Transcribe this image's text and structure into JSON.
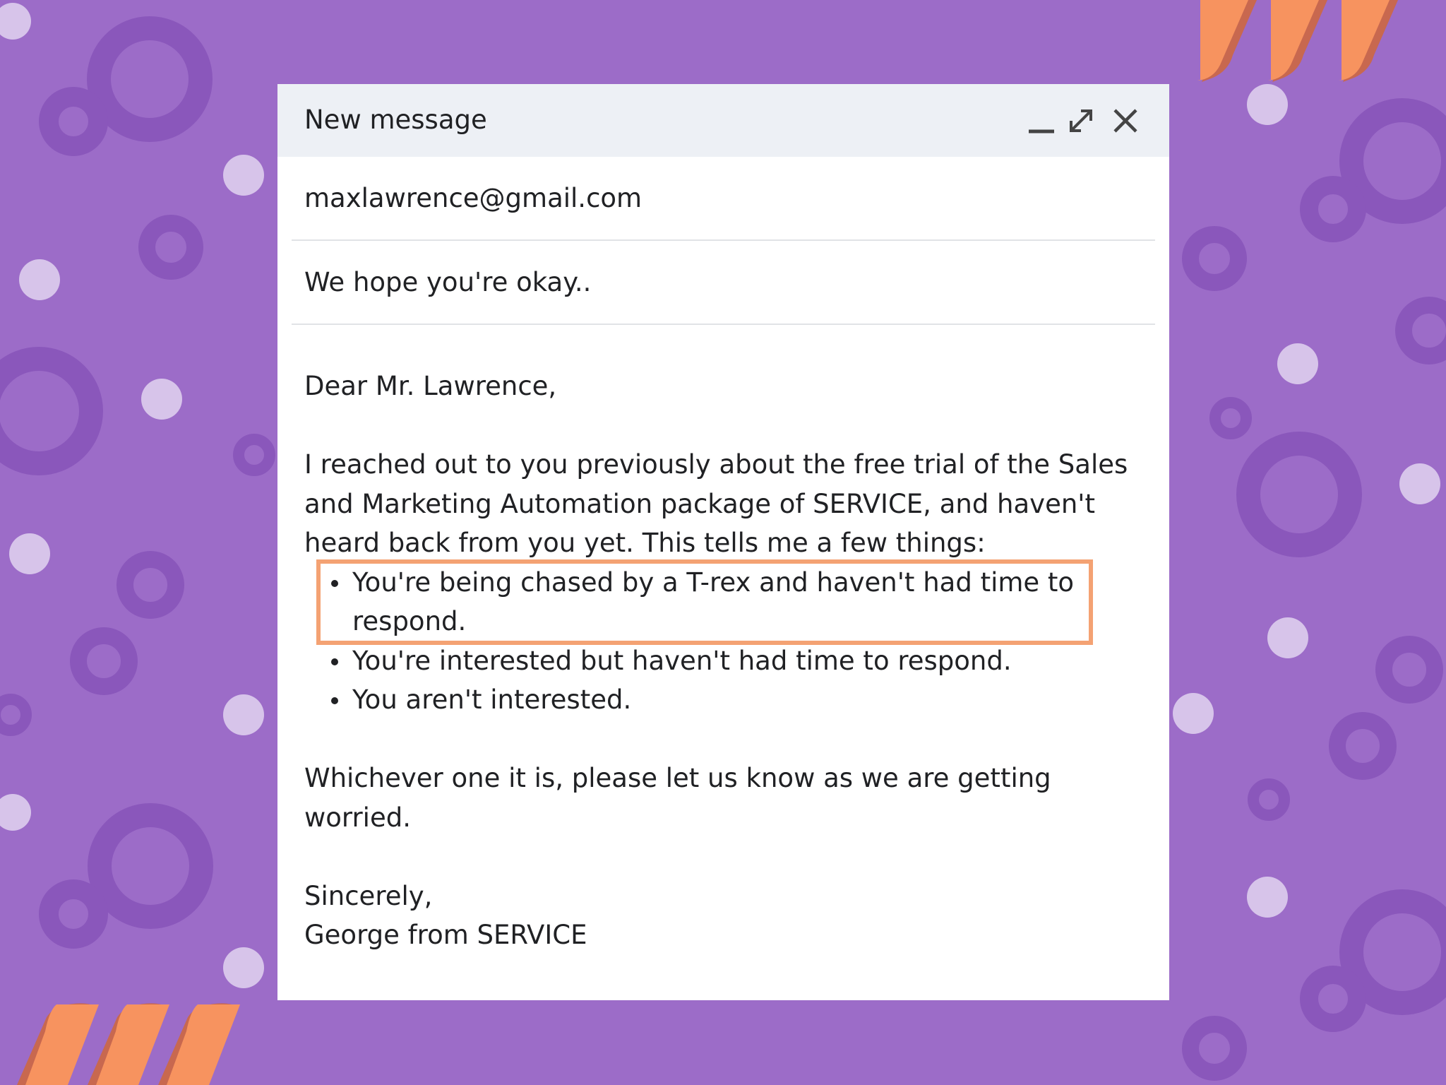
{
  "colors": {
    "background": "#9c6cc8",
    "decor_ring": "#8a57bb",
    "decor_dot": "#d7c4ea",
    "stripe_light": "#f7935f",
    "stripe_dark": "#c8684f",
    "highlight_border": "#f4a273",
    "titlebar": "#edf0f5"
  },
  "window": {
    "title": "New message",
    "controls": [
      {
        "name": "minimize",
        "icon": "minimize-icon"
      },
      {
        "name": "expand",
        "icon": "expand-icon"
      },
      {
        "name": "close",
        "icon": "close-icon"
      }
    ]
  },
  "compose": {
    "to": "maxlawrence@gmail.com",
    "subject": "We hope you're okay..",
    "body": {
      "greeting": "Dear Mr. Lawrence,",
      "intro": "I reached out to you previously about the free trial of the Sales and Marketing Automation package of SERVICE, and haven't heard back from you yet. This tells me a few things:",
      "bullets": [
        "You're being chased by a T-rex and haven't had time to respond.",
        "You're interested but haven't had time to respond.",
        "You aren't interested."
      ],
      "followup": "Whichever one it is, please let us know as we are getting worried.",
      "signoff": "Sincerely,",
      "signature": "George from SERVICE"
    }
  },
  "highlight": {
    "target": "bullet-1"
  }
}
